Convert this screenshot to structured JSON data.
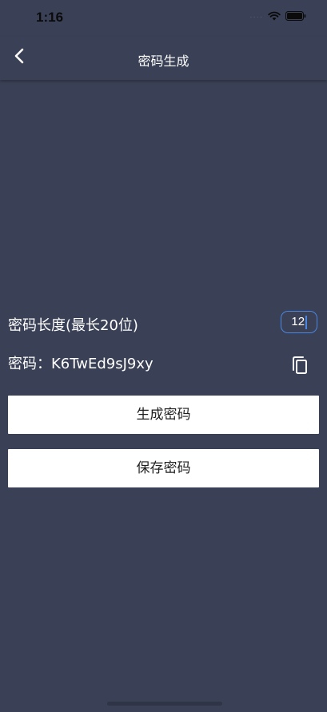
{
  "status_bar": {
    "time": "1:16",
    "signal": "....",
    "wifi_icon": "wifi-icon",
    "battery_icon": "battery-icon"
  },
  "nav": {
    "title": "密码生成",
    "back_icon": "chevron-left-icon"
  },
  "length": {
    "label": "密码长度(最长20位)",
    "value": "12"
  },
  "password": {
    "label": "密码：",
    "value": "K6TwEd9sJ9xy",
    "copy_icon": "copy-icon"
  },
  "buttons": {
    "generate_label": "生成密码",
    "save_label": "保存密码"
  },
  "colors": {
    "background": "#3a4055",
    "accent": "#4b86e0",
    "button_bg": "#ffffff"
  }
}
